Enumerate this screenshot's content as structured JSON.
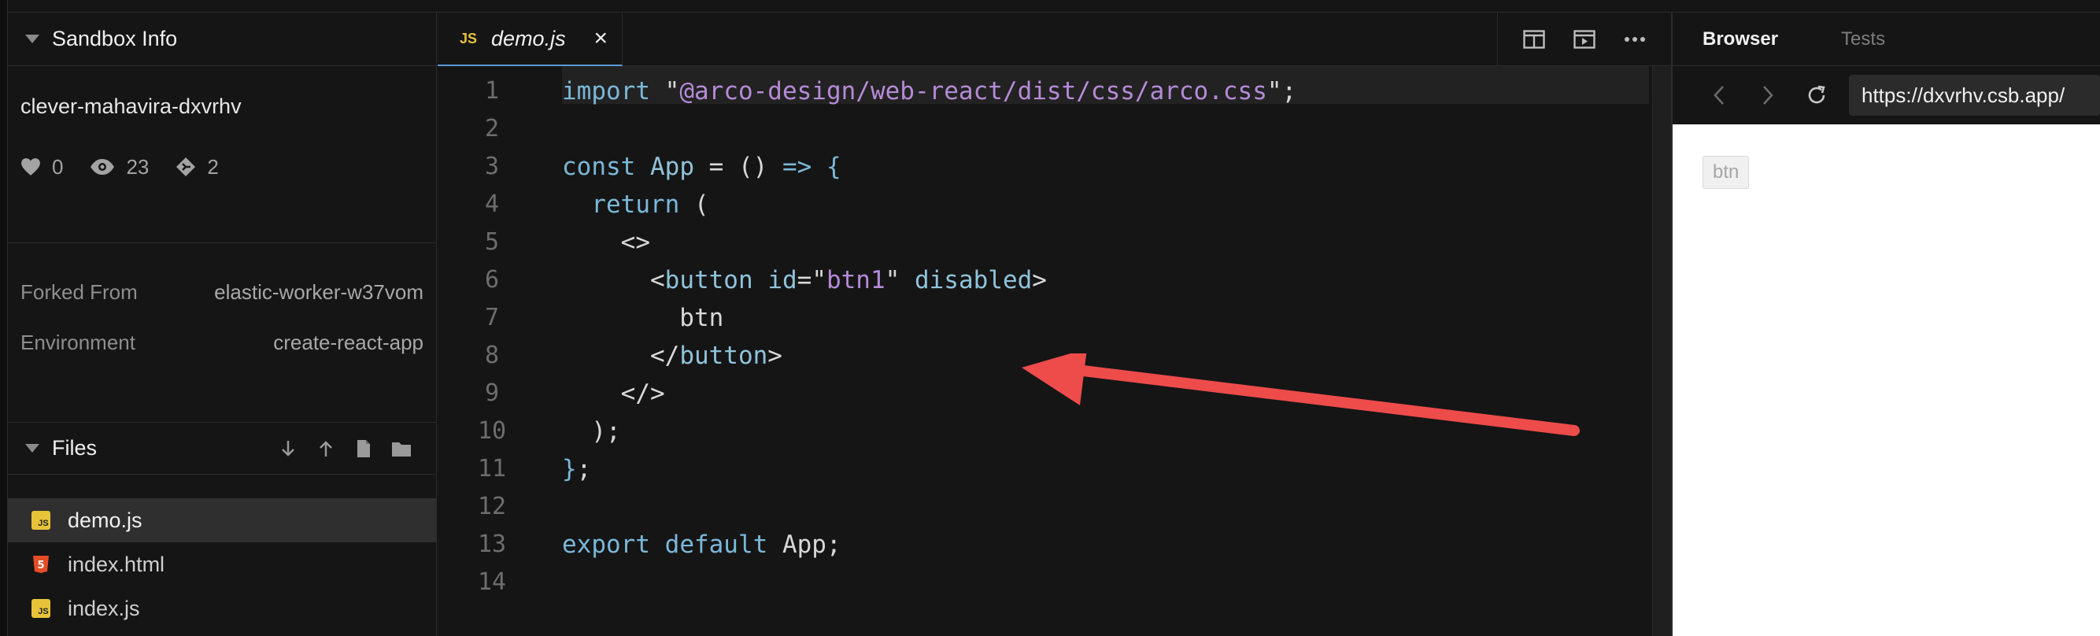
{
  "sidebar": {
    "sandbox_info_title": "Sandbox Info",
    "sandbox_name": "clever-mahavira-dxvrhv",
    "stats": {
      "likes": "0",
      "views": "23",
      "forks": "2"
    },
    "forked_from_label": "Forked From",
    "forked_from_value": "elastic-worker-w37vom",
    "environment_label": "Environment",
    "environment_value": "create-react-app",
    "files_title": "Files",
    "files": [
      {
        "name": "demo.js",
        "type": "js"
      },
      {
        "name": "index.html",
        "type": "html"
      },
      {
        "name": "index.js",
        "type": "js"
      }
    ]
  },
  "editor": {
    "tab": {
      "badge": "JS",
      "name": "demo.js",
      "close": "×"
    },
    "line_numbers": [
      "1",
      "2",
      "3",
      "4",
      "5",
      "6",
      "7",
      "8",
      "9",
      "10",
      "11",
      "12",
      "13",
      "14"
    ],
    "code_lines": [
      "import \"@arco-design/web-react/dist/css/arco.css\";",
      "",
      "const App = () => {",
      "  return (",
      "    <>",
      "      <button id=\"btn1\" disabled>",
      "        btn",
      "      </button>",
      "    </>",
      "  );",
      "};",
      "",
      "export default App;",
      ""
    ]
  },
  "browser": {
    "tabs": [
      "Browser",
      "Tests"
    ],
    "url": "https://dxvrhv.csb.app/",
    "preview_button_label": "btn"
  },
  "colors": {
    "background": "#151515",
    "accent_tab_underline": "#5b9bd5",
    "js_icon": "#e8c33a",
    "html_icon": "#e44d26",
    "arrow": "#ee4b4b"
  }
}
